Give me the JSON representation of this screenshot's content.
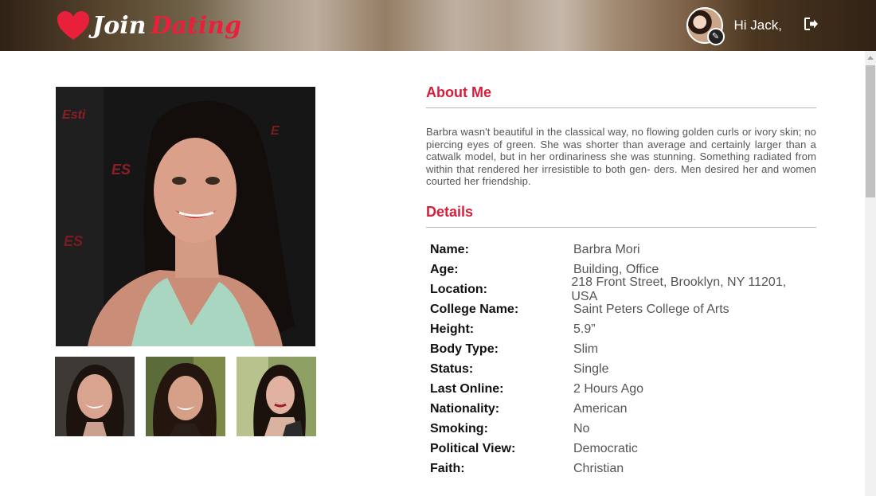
{
  "header": {
    "logo_join": "Join",
    "logo_dating": "Dating",
    "greeting": "Hi Jack,"
  },
  "colors": {
    "accent": "#d71d3a",
    "heart": "#e8203a"
  },
  "icons": {
    "logout": "logout-icon",
    "edit": "pencil-icon"
  },
  "about": {
    "title": "About Me",
    "text": "Barbra wasn't beautiful in the classical way, no flowing golden curls or ivory skin; no piercing eyes of green. She was shorter than average and certainly larger than a catwalk model, but in her ordinariness she was stunning. Something radiated from within that rendered her irresistible to both gen- ders. Men desired her and women courted her friendship."
  },
  "details": {
    "title": "Details",
    "rows": [
      {
        "label": "Name:",
        "value": "Barbra Mori"
      },
      {
        "label": "Age:",
        "value": "Building, Office"
      },
      {
        "label": "Location:",
        "value": "218 Front Street, Brooklyn, NY 11201, USA"
      },
      {
        "label": "College Name:",
        "value": "Saint Peters College of Arts"
      },
      {
        "label": "Height:",
        "value": "5.9”"
      },
      {
        "label": "Body Type:",
        "value": "Slim"
      },
      {
        "label": "Status:",
        "value": "Single"
      },
      {
        "label": "Last Online:",
        "value": "2 Hours Ago"
      },
      {
        "label": "Nationality:",
        "value": "American"
      },
      {
        "label": "Smoking:",
        "value": "No"
      },
      {
        "label": "Political View:",
        "value": "Democratic"
      },
      {
        "label": "Faith:",
        "value": "Christian"
      }
    ]
  }
}
